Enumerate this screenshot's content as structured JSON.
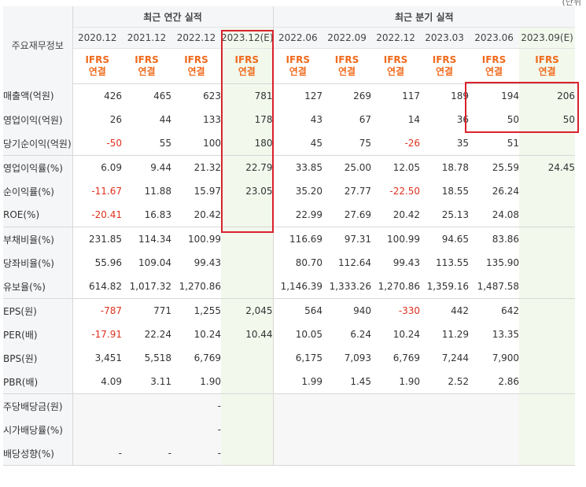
{
  "unit_text": "(단위",
  "header": {
    "label": "주요재무정보",
    "annual_title": "최근 연간 실적",
    "quarter_title": "최근 분기 실적",
    "periods": [
      "2020.12",
      "2021.12",
      "2022.12",
      "2023.12(E)",
      "2022.06",
      "2022.09",
      "2022.12",
      "2023.03",
      "2023.06",
      "2023.09(E)"
    ],
    "ifrs_top": "IFRS",
    "ifrs_bottom": "연결"
  },
  "rows": [
    {
      "label": "매출액(억원)",
      "values": [
        "426",
        "465",
        "623",
        "781",
        "127",
        "269",
        "117",
        "189",
        "194",
        "206"
      ]
    },
    {
      "label": "영업이익(억원)",
      "values": [
        "26",
        "44",
        "133",
        "178",
        "43",
        "67",
        "14",
        "36",
        "50",
        "50"
      ]
    },
    {
      "label": "당기순이익(억원)",
      "values": [
        "-50",
        "55",
        "100",
        "180",
        "45",
        "75",
        "-26",
        "35",
        "51",
        ""
      ]
    },
    {
      "label": "영업이익률(%)",
      "values": [
        "6.09",
        "9.44",
        "21.32",
        "22.79",
        "33.85",
        "25.00",
        "12.05",
        "18.78",
        "25.59",
        "24.45"
      ]
    },
    {
      "label": "순이익률(%)",
      "values": [
        "-11.67",
        "11.88",
        "15.97",
        "23.05",
        "35.20",
        "27.77",
        "-22.50",
        "18.55",
        "26.24",
        ""
      ]
    },
    {
      "label": "ROE(%)",
      "values": [
        "-20.41",
        "16.83",
        "20.42",
        "",
        "22.99",
        "27.69",
        "20.42",
        "25.13",
        "24.08",
        ""
      ]
    },
    {
      "label": "부채비율(%)",
      "values": [
        "231.85",
        "114.34",
        "100.99",
        "",
        "116.69",
        "97.31",
        "100.99",
        "94.65",
        "83.86",
        ""
      ]
    },
    {
      "label": "당좌비율(%)",
      "values": [
        "55.96",
        "109.04",
        "99.43",
        "",
        "80.70",
        "112.64",
        "99.43",
        "113.55",
        "135.90",
        ""
      ]
    },
    {
      "label": "유보율(%)",
      "values": [
        "614.82",
        "1,017.32",
        "1,270.86",
        "",
        "1,146.39",
        "1,333.26",
        "1,270.86",
        "1,359.16",
        "1,487.58",
        ""
      ]
    },
    {
      "label": "EPS(원)",
      "values": [
        "-787",
        "771",
        "1,255",
        "2,045",
        "564",
        "940",
        "-330",
        "442",
        "642",
        ""
      ]
    },
    {
      "label": "PER(배)",
      "values": [
        "-17.91",
        "22.24",
        "10.24",
        "10.44",
        "10.05",
        "6.24",
        "10.24",
        "11.29",
        "13.35",
        ""
      ]
    },
    {
      "label": "BPS(원)",
      "values": [
        "3,451",
        "5,518",
        "6,769",
        "",
        "6,175",
        "7,093",
        "6,769",
        "7,244",
        "7,900",
        ""
      ]
    },
    {
      "label": "PBR(배)",
      "values": [
        "4.09",
        "3.11",
        "1.90",
        "",
        "1.99",
        "1.45",
        "1.90",
        "2.52",
        "2.86",
        ""
      ]
    },
    {
      "label": "주당배당금(원)",
      "values": [
        "",
        "",
        "-",
        "",
        "",
        "",
        "",
        "",
        "",
        ""
      ]
    },
    {
      "label": "시가배당률(%)",
      "values": [
        "",
        "",
        "-",
        "",
        "",
        "",
        "",
        "",
        "",
        ""
      ]
    },
    {
      "label": "배당성향(%)",
      "values": [
        "-",
        "-",
        "-",
        "",
        "",
        "",
        "",
        "",
        "",
        ""
      ]
    }
  ],
  "colors": {
    "negative": "#e0301e",
    "ifrs": "#f06a1c",
    "estimate_bg": "#f2f8ec",
    "highlight": "#d9222c"
  }
}
